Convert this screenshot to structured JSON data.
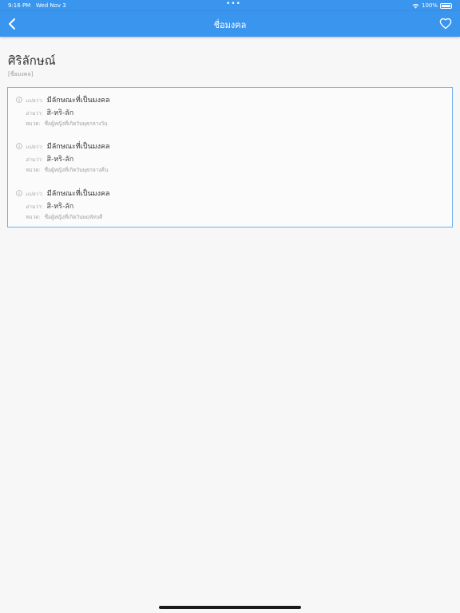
{
  "status_bar": {
    "time": "9:16 PM",
    "date": "Wed Nov 3",
    "dots": "•••",
    "battery": "100%"
  },
  "nav": {
    "title": "ชื่อมงคล"
  },
  "word": {
    "title": "ศิริลักษณ์",
    "category": "[ชื่อมงคล]"
  },
  "entries": [
    {
      "meaning_label": "แปลว่า:",
      "meaning": "มีลักษณะที่เป็นมงคล",
      "reading_label": "อ่านว่า:",
      "reading": "สิ-หริ-ลัก",
      "note_label": "หมวด:",
      "note": "ชื่อผู้หญิงที่เกิดวันพุธกลางวัน"
    },
    {
      "meaning_label": "แปลว่า:",
      "meaning": "มีลักษณะที่เป็นมงคล",
      "reading_label": "อ่านว่า:",
      "reading": "สิ-หริ-ลัก",
      "note_label": "หมวด:",
      "note": "ชื่อผู้หญิงที่เกิดวันพุธกลางคืน"
    },
    {
      "meaning_label": "แปลว่า:",
      "meaning": "มีลักษณะที่เป็นมงคล",
      "reading_label": "อ่านว่า:",
      "reading": "สิ-หริ-ลัก",
      "note_label": "หมวด:",
      "note": "ชื่อผู้หญิงที่เกิดวันพฤหัสบดี"
    }
  ],
  "colors": {
    "accent": "#3a95ee",
    "card_border": "#6fb0ee",
    "background": "#f7f7f7"
  },
  "icons": {
    "back": "chevron-left-icon",
    "favorite": "heart-icon",
    "info": "info-icon",
    "wifi": "wifi-icon",
    "battery": "battery-icon"
  }
}
